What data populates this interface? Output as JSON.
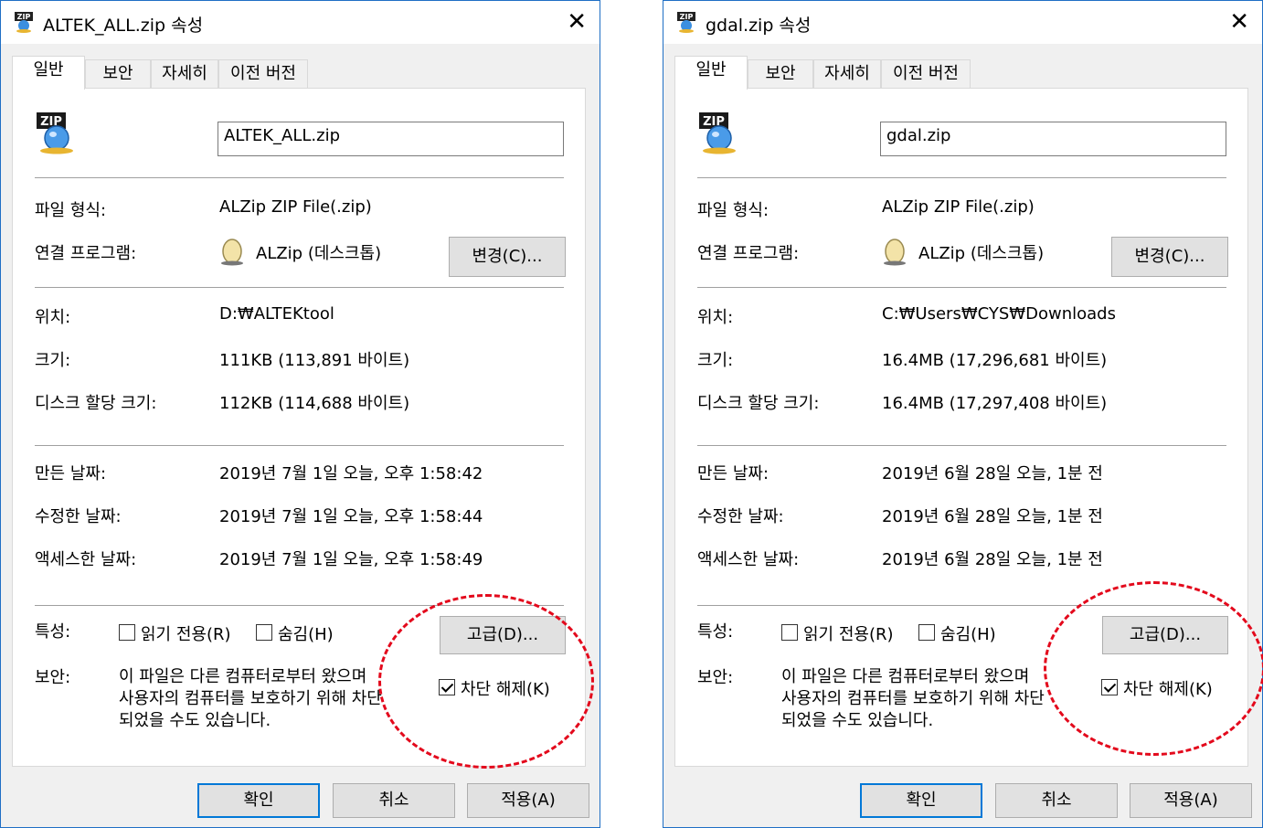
{
  "left": {
    "title": "ALTEK_ALL.zip 속성",
    "close_icon": "close-icon",
    "tabs": [
      "일반",
      "보안",
      "자세히",
      "이전 버전"
    ],
    "filename": "ALTEK_ALL.zip",
    "file_icon_text": "ZIP",
    "type_label": "파일 형식:",
    "type_value": "ALZip ZIP File(.zip)",
    "openwith_label": "연결 프로그램:",
    "openwith_value": "ALZip (데스크톱)",
    "change_button": "변경(C)...",
    "location_label": "위치:",
    "location_value": "D:₩ALTEKtool",
    "size_label": "크기:",
    "size_value": "111KB (113,891 바이트)",
    "disksize_label": "디스크 할당 크기:",
    "disksize_value": "112KB (114,688 바이트)",
    "created_label": "만든 날짜:",
    "created_value": "2019년 7월 1일 오늘, 오후 1:58:42",
    "modified_label": "수정한 날짜:",
    "modified_value": "2019년 7월 1일 오늘, 오후 1:58:44",
    "accessed_label": "액세스한 날짜:",
    "accessed_value": "2019년 7월 1일 오늘, 오후 1:58:49",
    "attributes_label": "특성:",
    "readonly_label": "읽기 전용(R)",
    "hidden_label": "숨김(H)",
    "advanced_button": "고급(D)...",
    "security_label": "보안:",
    "security_line1": "이 파일은 다른 컴퓨터로부터 왔으며",
    "security_line2": "사용자의 컴퓨터를 보호하기 위해 차단",
    "security_line3": "되었을 수도 있습니다.",
    "unblock_label": "차단 해제(K)",
    "unblock_checked": true,
    "ok_button": "확인",
    "cancel_button": "취소",
    "apply_button": "적용(A)"
  },
  "right": {
    "title": "gdal.zip 속성",
    "close_icon": "close-icon",
    "tabs": [
      "일반",
      "보안",
      "자세히",
      "이전 버전"
    ],
    "filename": "gdal.zip",
    "file_icon_text": "ZIP",
    "type_label": "파일 형식:",
    "type_value": "ALZip ZIP File(.zip)",
    "openwith_label": "연결 프로그램:",
    "openwith_value": "ALZip (데스크톱)",
    "change_button": "변경(C)...",
    "location_label": "위치:",
    "location_value": "C:₩Users₩CYS₩Downloads",
    "size_label": "크기:",
    "size_value": "16.4MB (17,296,681 바이트)",
    "disksize_label": "디스크 할당 크기:",
    "disksize_value": "16.4MB (17,297,408 바이트)",
    "created_label": "만든 날짜:",
    "created_value": "2019년 6월 28일 오늘, 1분 전",
    "modified_label": "수정한 날짜:",
    "modified_value": "2019년 6월 28일 오늘, 1분 전",
    "accessed_label": "액세스한 날짜:",
    "accessed_value": "2019년 6월 28일 오늘, 1분 전",
    "attributes_label": "특성:",
    "readonly_label": "읽기 전용(R)",
    "hidden_label": "숨김(H)",
    "advanced_button": "고급(D)...",
    "security_label": "보안:",
    "security_line1": "이 파일은 다른 컴퓨터로부터 왔으며",
    "security_line2": "사용자의 컴퓨터를 보호하기 위해 차단",
    "security_line3": "되었을 수도 있습니다.",
    "unblock_label": "차단 해제(K)",
    "unblock_checked": true,
    "ok_button": "확인",
    "cancel_button": "취소",
    "apply_button": "적용(A)"
  },
  "colors": {
    "accent": "#0078d7",
    "highlight_circle": "#e3091c"
  }
}
